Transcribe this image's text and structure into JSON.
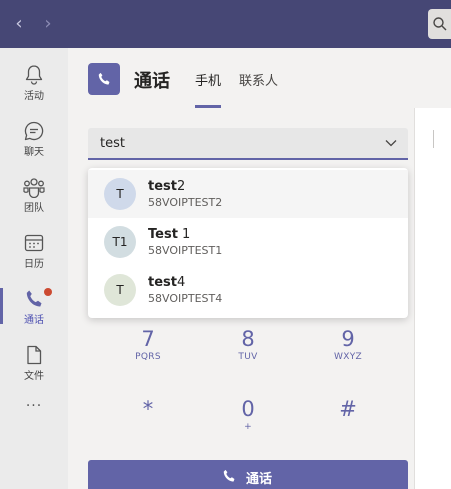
{
  "nav": {
    "back_glyph": "‹",
    "forward_glyph": "›"
  },
  "rail": {
    "items": [
      {
        "label": "活动",
        "icon": "bell-icon"
      },
      {
        "label": "聊天",
        "icon": "chat-icon"
      },
      {
        "label": "团队",
        "icon": "teams-icon"
      },
      {
        "label": "日历",
        "icon": "calendar-icon"
      },
      {
        "label": "通话",
        "icon": "phone-icon"
      },
      {
        "label": "文件",
        "icon": "file-icon"
      }
    ],
    "more": "···"
  },
  "header": {
    "title": "通话",
    "tabs": [
      "手机",
      "联系人"
    ]
  },
  "dial": {
    "input_value": "test"
  },
  "suggestions": [
    {
      "initials": "T",
      "name_bold": "test",
      "name_rest": "2",
      "number": "58VOIPTEST2",
      "avatar_color": "#cfd9ea"
    },
    {
      "initials": "T1",
      "name_bold": "Test",
      "name_rest": " 1",
      "number": "58VOIPTEST1",
      "avatar_color": "#d2dde1"
    },
    {
      "initials": "T",
      "name_bold": "test",
      "name_rest": "4",
      "number": "58VOIPTEST4",
      "avatar_color": "#dfe6d8"
    }
  ],
  "keypad": [
    {
      "digit": "7",
      "letters": "PQRS"
    },
    {
      "digit": "8",
      "letters": "TUV"
    },
    {
      "digit": "9",
      "letters": "WXYZ"
    },
    {
      "digit": "*",
      "letters": ""
    },
    {
      "digit": "0",
      "letters": "+"
    },
    {
      "digit": "#",
      "letters": ""
    }
  ],
  "call_button": {
    "label": "通话"
  },
  "colors": {
    "brand": "#6264a7",
    "topbar": "#464775",
    "notification": "#cc4a31"
  }
}
